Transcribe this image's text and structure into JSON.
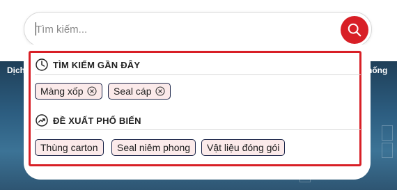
{
  "search": {
    "placeholder": "Tìm kiếm...",
    "value": ""
  },
  "background": {
    "nav_left_text": "Dịch",
    "nav_right_text": "hống"
  },
  "recent": {
    "title": "TÌM KIẾM GẦN ĐÂY",
    "items": [
      {
        "label": "Màng xốp"
      },
      {
        "label": "Seal cáp"
      }
    ]
  },
  "popular": {
    "title": "ĐỀ XUẤT PHỔ BIẾN",
    "items": [
      {
        "label": "Thùng carton"
      },
      {
        "label": "Seal niêm phong"
      },
      {
        "label": "Vật liệu đóng gói"
      }
    ]
  },
  "colors": {
    "accent": "#d81f26",
    "chip_bg": "#fbeaea",
    "chip_border": "#1a2448"
  },
  "icons": {
    "search_button": "search-icon",
    "recent": "clock-icon",
    "popular": "trending-up-icon",
    "chip_remove": "close-circle-icon"
  }
}
